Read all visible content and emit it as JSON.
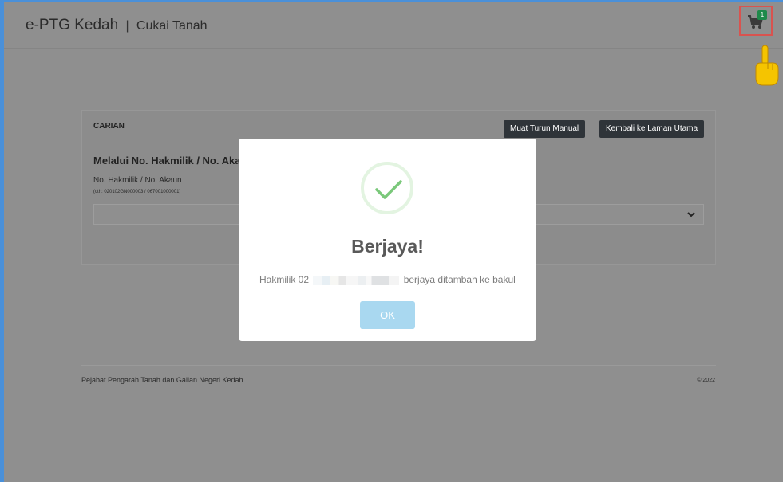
{
  "header": {
    "app_name": "e-PTG Kedah",
    "separator": "|",
    "subtitle": "Cukai Tanah",
    "cart_count": "1"
  },
  "search_panel": {
    "title": "CARIAN",
    "buttons": {
      "download_manual": "Muat Turun Manual",
      "back_home": "Kembali ke Laman Utama"
    },
    "section_title": "Melalui No. Hakmilik / No. Akaun",
    "field_label": "No. Hakmilik / No. Akaun",
    "field_hint": "(cth: 020102GN000003 / 067001000001)",
    "select_value": ""
  },
  "footer": {
    "agency": "Pejabat Pengarah Tanah dan Galian Negeri Kedah",
    "copyright": "© 2022"
  },
  "modal": {
    "title": "Berjaya!",
    "message_prefix": "Hakmilik 02",
    "message_suffix": "berjaya ditambah ke bakul",
    "ok_label": "OK"
  },
  "colors": {
    "overlay": "#8f8f8f",
    "highlight_border": "#d9534f",
    "success_green": "#7ac87a",
    "ok_button": "#a9d8f0",
    "dark_button": "#2f3439",
    "badge": "#1e8a4a"
  }
}
